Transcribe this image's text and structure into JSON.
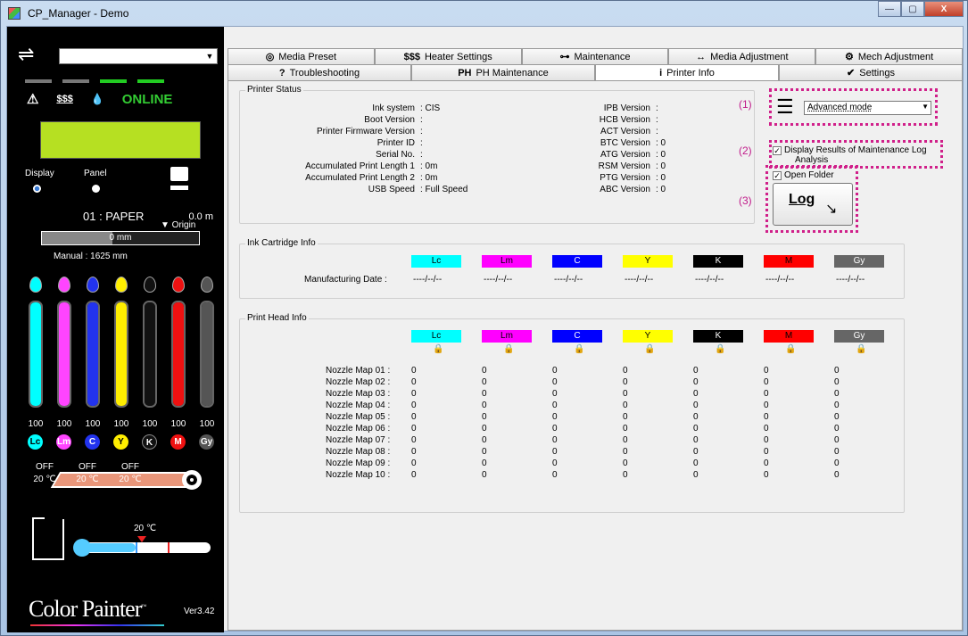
{
  "window": {
    "title": "CP_Manager - Demo",
    "min": "—",
    "max": "▢",
    "close": "X"
  },
  "left": {
    "arrows_icon": "⇌",
    "printer_select": "",
    "status_warn": "⚠",
    "status_heater": "$$$",
    "status_ink": "💧",
    "online": "ONLINE",
    "display_label": "Display",
    "panel_label": "Panel",
    "media": "01 : PAPER",
    "media_pos": "0.0 m",
    "origin": "▼ Origin",
    "bar_value": "0 mm",
    "bar_progress": 0.45,
    "manual": "Manual : 1625 mm",
    "inks": [
      {
        "code": "Lc",
        "color": "#00ffff",
        "pct": "100",
        "level": 100
      },
      {
        "code": "Lm",
        "color": "#ff44ff",
        "pct": "100",
        "level": 100
      },
      {
        "code": "C",
        "color": "#2233ee",
        "pct": "100",
        "level": 100
      },
      {
        "code": "Y",
        "color": "#ffee00",
        "pct": "100",
        "level": 100
      },
      {
        "code": "K",
        "color": "#111111",
        "pct": "100",
        "level": 100
      },
      {
        "code": "M",
        "color": "#ee1111",
        "pct": "100",
        "level": 100
      },
      {
        "code": "Gy",
        "color": "#555555",
        "pct": "100",
        "level": 100
      }
    ],
    "heaters": [
      {
        "state": "OFF",
        "temp": "20 ℃"
      },
      {
        "state": "OFF",
        "temp": "20 ℃"
      },
      {
        "state": "OFF",
        "temp": "20 ℃"
      }
    ],
    "room_temp": "20 ℃",
    "logo": "Color Painter",
    "logo_tm": "™",
    "version": "Ver3.42"
  },
  "tabs": {
    "row1": [
      {
        "label": "Media Preset",
        "icon": "◎"
      },
      {
        "label": "Heater Settings",
        "icon": "$$$"
      },
      {
        "label": "Maintenance",
        "icon": "⊶"
      },
      {
        "label": "Media Adjustment",
        "icon": "↔"
      },
      {
        "label": "Mech Adjustment",
        "icon": "⚙"
      }
    ],
    "row2": [
      {
        "label": "Troubleshooting",
        "icon": "?"
      },
      {
        "label": "PH Maintenance",
        "icon": "PH"
      },
      {
        "label": "Printer Info",
        "icon": "i",
        "active": true
      },
      {
        "label": "Settings",
        "icon": "✔"
      }
    ]
  },
  "printer_status": {
    "title": "Printer Status",
    "left": [
      {
        "k": "Ink system",
        "v": ": CIS"
      },
      {
        "k": "Boot Version",
        "v": ":"
      },
      {
        "k": "Printer Firmware Version",
        "v": ":"
      },
      {
        "k": "Printer ID",
        "v": ":"
      },
      {
        "k": "Serial No.",
        "v": ":"
      },
      {
        "k": "Accumulated Print Length 1",
        "v": ": 0m"
      },
      {
        "k": "Accumulated Print Length 2",
        "v": ": 0m"
      },
      {
        "k": "USB Speed",
        "v": ": Full Speed"
      }
    ],
    "right": [
      {
        "k": "IPB Version",
        "v": ":"
      },
      {
        "k": "HCB Version",
        "v": ":"
      },
      {
        "k": "ACT Version",
        "v": ":"
      },
      {
        "k": "BTC Version",
        "v": ": 0"
      },
      {
        "k": "ATG Version",
        "v": ": 0"
      },
      {
        "k": "RSM Version",
        "v": ": 0"
      },
      {
        "k": "PTG Version",
        "v": ": 0"
      },
      {
        "k": "ABC Version",
        "v": ": 0"
      }
    ]
  },
  "controls": {
    "anno1": "(1)",
    "anno2": "(2)",
    "anno3": "(3)",
    "mode": "Advanced mode",
    "display_results_line1": "Display Results of Maintenance Log",
    "display_results_line2": "Analysis",
    "open_folder": "Open Folder",
    "log_label": "Log"
  },
  "ink_cartridge": {
    "title": "Ink Cartridge Info",
    "mfg_label": "Manufacturing Date :",
    "cols": [
      {
        "name": "Lc",
        "bg": "#00ffff",
        "fg": "#000",
        "date": "----/--/--"
      },
      {
        "name": "Lm",
        "bg": "#ff00ff",
        "fg": "#000",
        "date": "----/--/--"
      },
      {
        "name": "C",
        "bg": "#0000ff",
        "fg": "#fff",
        "date": "----/--/--"
      },
      {
        "name": "Y",
        "bg": "#ffff00",
        "fg": "#000",
        "date": "----/--/--"
      },
      {
        "name": "K",
        "bg": "#000000",
        "fg": "#fff",
        "date": "----/--/--"
      },
      {
        "name": "M",
        "bg": "#ff0000",
        "fg": "#000",
        "date": "----/--/--"
      },
      {
        "name": "Gy",
        "bg": "#666666",
        "fg": "#fff",
        "date": "----/--/--"
      }
    ]
  },
  "print_head": {
    "title": "Print Head Info",
    "cols": [
      {
        "name": "Lc",
        "bg": "#00ffff",
        "fg": "#000"
      },
      {
        "name": "Lm",
        "bg": "#ff00ff",
        "fg": "#000"
      },
      {
        "name": "C",
        "bg": "#0000ff",
        "fg": "#fff"
      },
      {
        "name": "Y",
        "bg": "#ffff00",
        "fg": "#000"
      },
      {
        "name": "K",
        "bg": "#000000",
        "fg": "#fff"
      },
      {
        "name": "M",
        "bg": "#ff0000",
        "fg": "#000"
      },
      {
        "name": "Gy",
        "bg": "#666666",
        "fg": "#fff"
      }
    ],
    "rows": [
      {
        "label": "Nozzle Map 01 :",
        "vals": [
          "0",
          "0",
          "0",
          "0",
          "0",
          "0",
          "0"
        ]
      },
      {
        "label": "Nozzle Map 02 :",
        "vals": [
          "0",
          "0",
          "0",
          "0",
          "0",
          "0",
          "0"
        ]
      },
      {
        "label": "Nozzle Map 03 :",
        "vals": [
          "0",
          "0",
          "0",
          "0",
          "0",
          "0",
          "0"
        ]
      },
      {
        "label": "Nozzle Map 04 :",
        "vals": [
          "0",
          "0",
          "0",
          "0",
          "0",
          "0",
          "0"
        ]
      },
      {
        "label": "Nozzle Map 05 :",
        "vals": [
          "0",
          "0",
          "0",
          "0",
          "0",
          "0",
          "0"
        ]
      },
      {
        "label": "Nozzle Map 06 :",
        "vals": [
          "0",
          "0",
          "0",
          "0",
          "0",
          "0",
          "0"
        ]
      },
      {
        "label": "Nozzle Map 07 :",
        "vals": [
          "0",
          "0",
          "0",
          "0",
          "0",
          "0",
          "0"
        ]
      },
      {
        "label": "Nozzle Map 08 :",
        "vals": [
          "0",
          "0",
          "0",
          "0",
          "0",
          "0",
          "0"
        ]
      },
      {
        "label": "Nozzle Map 09 :",
        "vals": [
          "0",
          "0",
          "0",
          "0",
          "0",
          "0",
          "0"
        ]
      },
      {
        "label": "Nozzle Map 10 :",
        "vals": [
          "0",
          "0",
          "0",
          "0",
          "0",
          "0",
          "0"
        ]
      }
    ]
  }
}
